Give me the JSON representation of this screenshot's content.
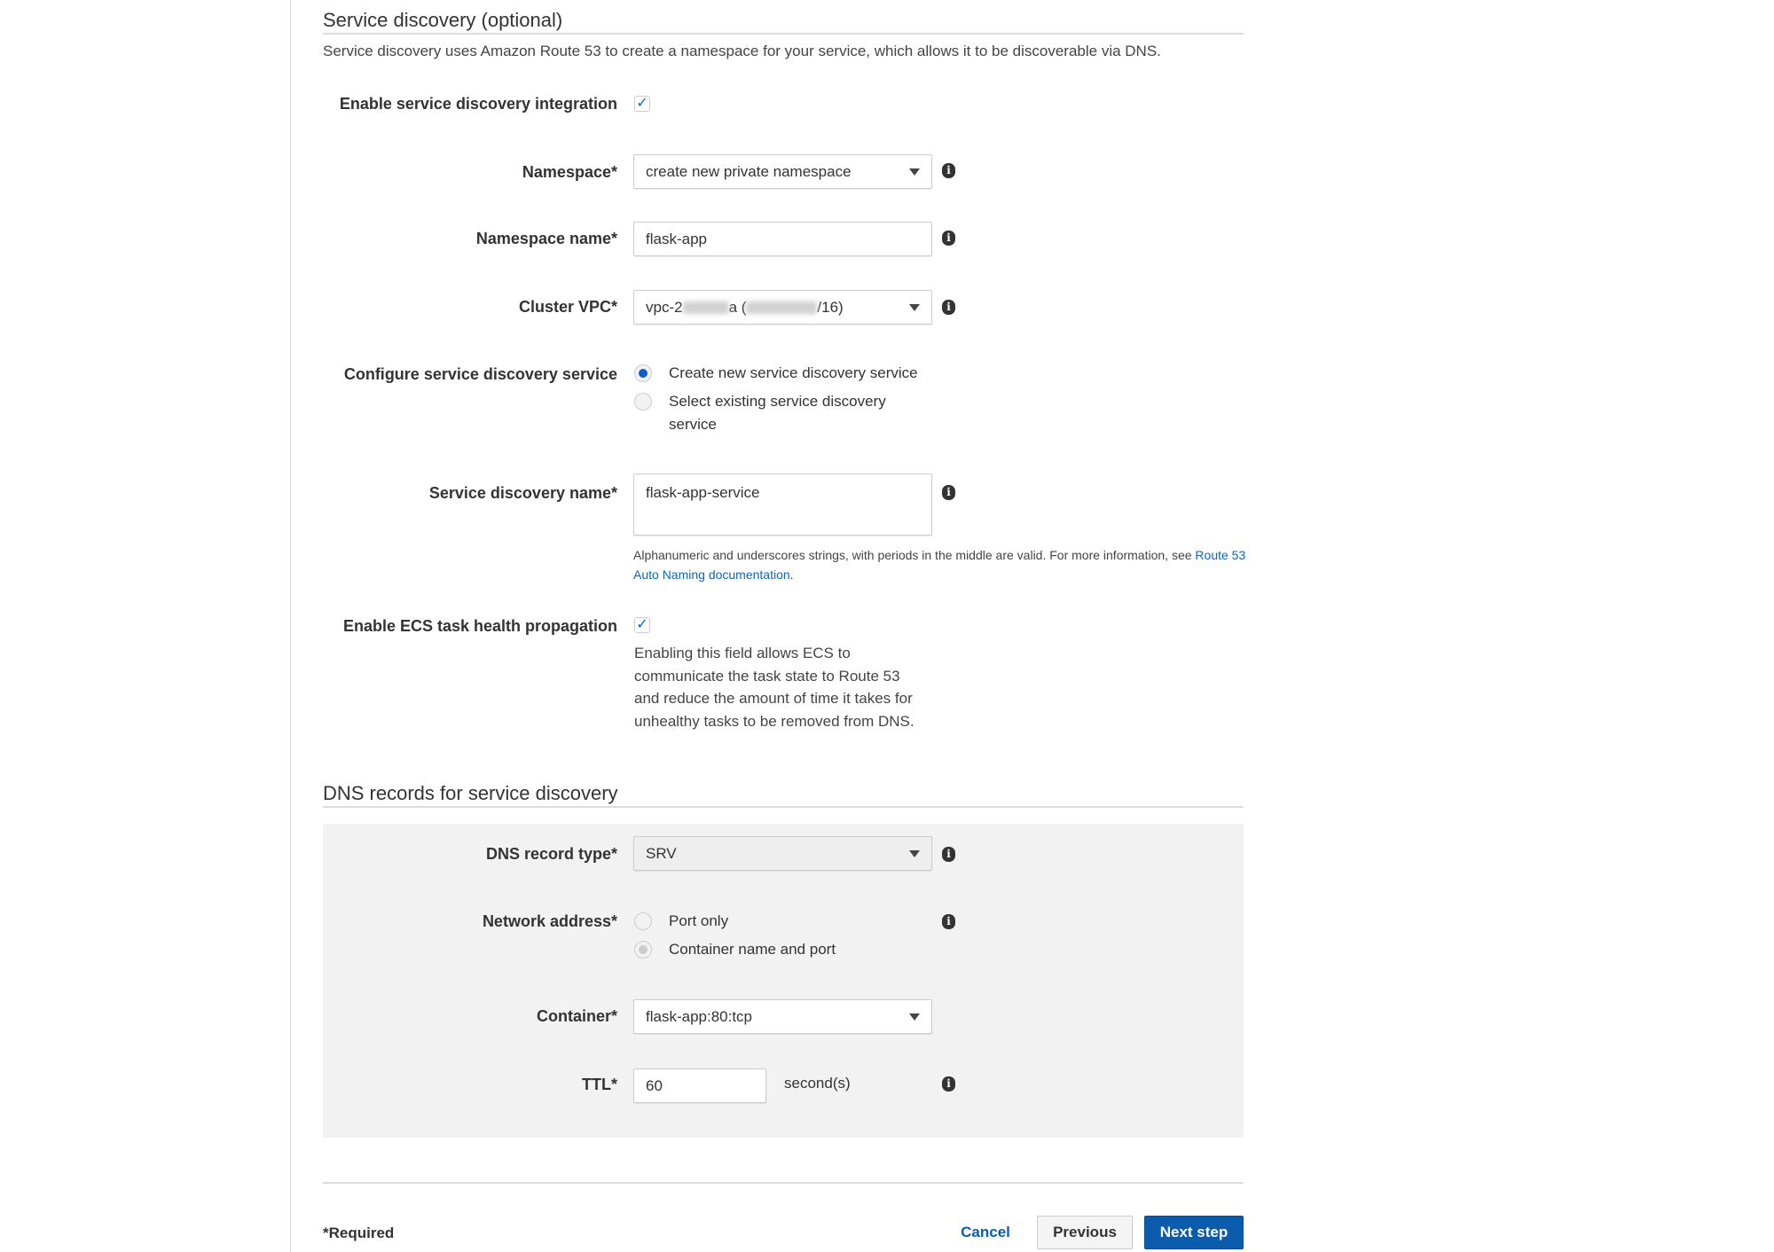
{
  "section1": {
    "title": "Service discovery (optional)",
    "description": "Service discovery uses Amazon Route 53 to create a namespace for your service, which allows it to be discoverable via DNS."
  },
  "fields": {
    "enable_sd": {
      "label": "Enable service discovery integration",
      "checked": true
    },
    "namespace": {
      "label": "Namespace*",
      "value": "create new private namespace"
    },
    "namespace_name": {
      "label": "Namespace name*",
      "value": "flask-app"
    },
    "cluster_vpc": {
      "label": "Cluster VPC*",
      "value_prefix": "vpc-2",
      "value_mid": "a (",
      "value_suffix": "/16)"
    },
    "configure_sd": {
      "label": "Configure service discovery service",
      "options": [
        "Create new service discovery service",
        "Select existing service discovery service"
      ],
      "selected": 0
    },
    "sd_name": {
      "label": "Service discovery name*",
      "value": "flask-app-service",
      "help": "Alphanumeric and underscores strings, with periods in the middle are valid. For more information, see",
      "help_link": "Route 53 Auto Naming documentation",
      "help_end": "."
    },
    "health": {
      "label": "Enable ECS task health propagation",
      "checked": true,
      "help": "Enabling this field allows ECS to communicate the task state to Route 53 and reduce the amount of time it takes for unhealthy tasks to be removed from DNS."
    }
  },
  "section2": {
    "title": "DNS records for service discovery"
  },
  "dns": {
    "record_type": {
      "label": "DNS record type*",
      "value": "SRV"
    },
    "network_address": {
      "label": "Network address*",
      "options": [
        "Port only",
        "Container name and port"
      ],
      "selected": 1
    },
    "container": {
      "label": "Container*",
      "value": "flask-app:80:tcp"
    },
    "ttl": {
      "label": "TTL*",
      "value": "60",
      "unit": "second(s)"
    }
  },
  "footer": {
    "required": "*Required",
    "cancel": "Cancel",
    "previous": "Previous",
    "next": "Next step"
  },
  "colors": {
    "accent": "#0a5fc4",
    "primary_button": "#0b5cad",
    "link": "#1166bb"
  }
}
